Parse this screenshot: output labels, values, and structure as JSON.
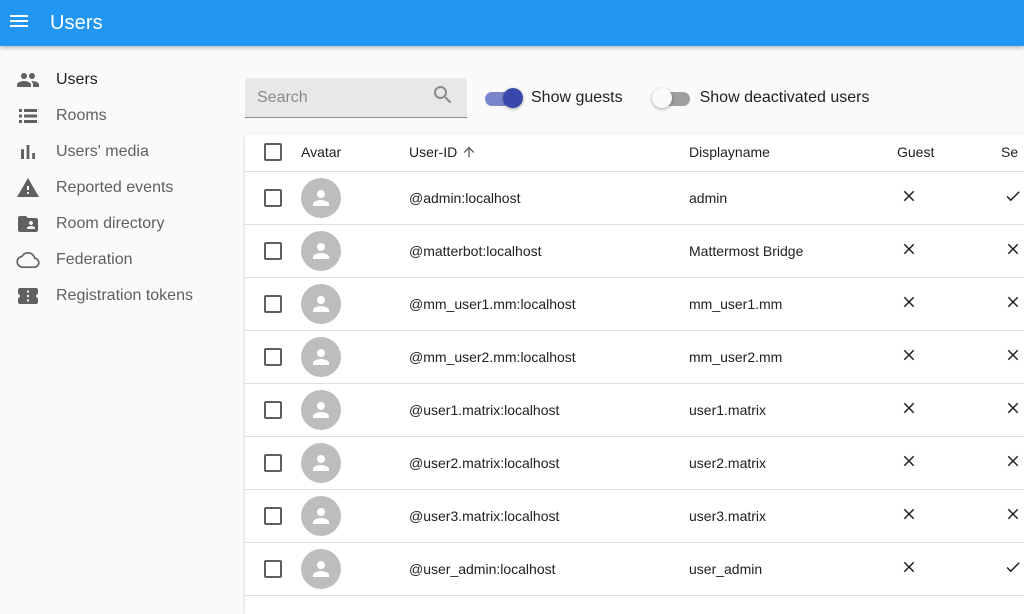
{
  "app": {
    "title": "Users"
  },
  "sidebar": {
    "items": [
      {
        "label": "Users",
        "icon": "people-icon"
      },
      {
        "label": "Rooms",
        "icon": "list-icon"
      },
      {
        "label": "Users' media",
        "icon": "bar-chart-icon"
      },
      {
        "label": "Reported events",
        "icon": "warning-icon"
      },
      {
        "label": "Room directory",
        "icon": "folder-shared-icon"
      },
      {
        "label": "Federation",
        "icon": "cloud-icon"
      },
      {
        "label": "Registration tokens",
        "icon": "ticket-icon"
      }
    ],
    "active_index": 0
  },
  "toolbar": {
    "search": {
      "placeholder": "Search",
      "value": ""
    },
    "show_guests": {
      "label": "Show guests",
      "checked": true
    },
    "show_deactivated": {
      "label": "Show deactivated users",
      "checked": false
    }
  },
  "table": {
    "columns": {
      "avatar": "Avatar",
      "user_id": "User-ID",
      "displayname": "Displayname",
      "guest": "Guest",
      "server_admin": "Se"
    },
    "sort": {
      "column": "User-ID",
      "direction": "ascending"
    },
    "rows": [
      {
        "user_id": "@admin:localhost",
        "displayname": "admin",
        "guest": false,
        "server_admin": true
      },
      {
        "user_id": "@matterbot:localhost",
        "displayname": "Mattermost Bridge",
        "guest": false,
        "server_admin": false
      },
      {
        "user_id": "@mm_user1.mm:localhost",
        "displayname": "mm_user1.mm",
        "guest": false,
        "server_admin": false
      },
      {
        "user_id": "@mm_user2.mm:localhost",
        "displayname": "mm_user2.mm",
        "guest": false,
        "server_admin": false
      },
      {
        "user_id": "@user1.matrix:localhost",
        "displayname": "user1.matrix",
        "guest": false,
        "server_admin": false
      },
      {
        "user_id": "@user2.matrix:localhost",
        "displayname": "user2.matrix",
        "guest": false,
        "server_admin": false
      },
      {
        "user_id": "@user3.matrix:localhost",
        "displayname": "user3.matrix",
        "guest": false,
        "server_admin": false
      },
      {
        "user_id": "@user_admin:localhost",
        "displayname": "user_admin",
        "guest": false,
        "server_admin": true
      }
    ]
  },
  "colors": {
    "primary": "#2196f3",
    "switch_on_thumb": "#3949ab",
    "switch_on_track": "#7986cb",
    "switch_off_thumb": "#fafafa",
    "switch_off_track": "#9e9e9e",
    "icon": "#616161"
  }
}
